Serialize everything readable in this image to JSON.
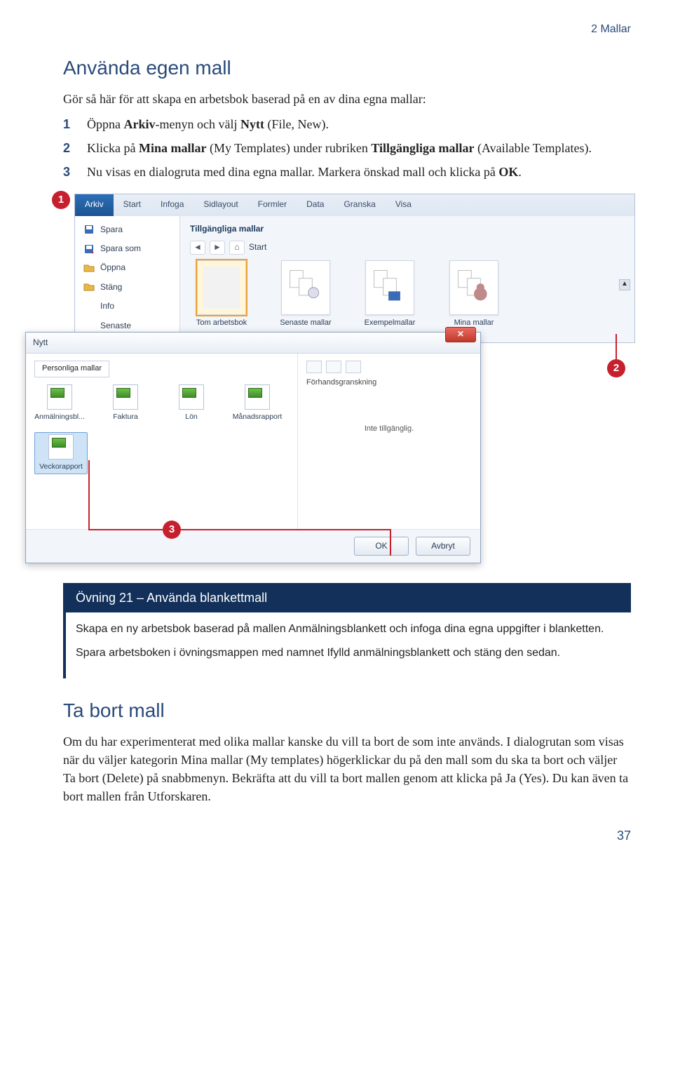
{
  "chapter_label": "2 Mallar",
  "section1_heading": "Använda egen mall",
  "section1_intro": "Gör så här för att skapa en arbetsbok baserad på en av dina egna mallar:",
  "steps": [
    {
      "num": "1",
      "html": "Öppna <b>Arkiv</b>-menyn och välj <b>Nytt</b> (File, New)."
    },
    {
      "num": "2",
      "html": "Klicka på <b>Mina mallar</b> (My Templates) under rubriken <b>Tillgängliga mallar</b> (Available Templates)."
    },
    {
      "num": "3",
      "html": "Nu visas en dialogruta med dina egna mallar. Markera önskad mall och klicka på <b>OK</b>."
    }
  ],
  "callouts": {
    "c1": "1",
    "c2": "2",
    "c3": "3"
  },
  "ribbon_tabs": [
    "Arkiv",
    "Start",
    "Infoga",
    "Sidlayout",
    "Formler",
    "Data",
    "Granska",
    "Visa"
  ],
  "bs_menu": [
    "Spara",
    "Spara som",
    "Öppna",
    "Stäng",
    "Info",
    "Senaste"
  ],
  "bs_section_title": "Tillgängliga mallar",
  "bs_crumb": "Start",
  "templates": [
    {
      "label": "Tom arbetsbok",
      "selected": true
    },
    {
      "label": "Senaste mallar",
      "selected": false
    },
    {
      "label": "Exempelmallar",
      "selected": false
    },
    {
      "label": "Mina mallar",
      "selected": false
    }
  ],
  "dialog": {
    "title": "Nytt",
    "tab": "Personliga mallar",
    "files": [
      {
        "name": "Anmälningsbl...",
        "selected": false
      },
      {
        "name": "Faktura",
        "selected": false
      },
      {
        "name": "Lön",
        "selected": false
      },
      {
        "name": "Månadsrapport",
        "selected": false
      },
      {
        "name": "Veckorapport",
        "selected": true
      }
    ],
    "preview_label": "Förhandsgranskning",
    "not_available": "Inte tillgänglig.",
    "ok": "OK",
    "cancel": "Avbryt"
  },
  "exercise": {
    "title": "Övning 21 – Använda blankettmall",
    "p1": "Skapa en ny arbetsbok baserad på mallen Anmälningsblankett och infoga dina egna uppgifter i blanketten.",
    "p2": "Spara arbetsboken i övningsmappen med namnet Ifylld anmälningsblankett och stäng den sedan."
  },
  "section2_heading": "Ta bort mall",
  "section2_body": "Om du har experimenterat med olika mallar kanske du vill ta bort de som inte används. I dialogrutan som visas när du väljer kategorin Mina mallar (My templates) högerklickar du på den mall som du ska ta bort och väljer Ta bort (Delete) på snabbmenyn. Bekräfta att du vill ta bort mallen genom att klicka på Ja (Yes). Du kan även ta bort mallen från Utforskaren.",
  "page_number": "37"
}
